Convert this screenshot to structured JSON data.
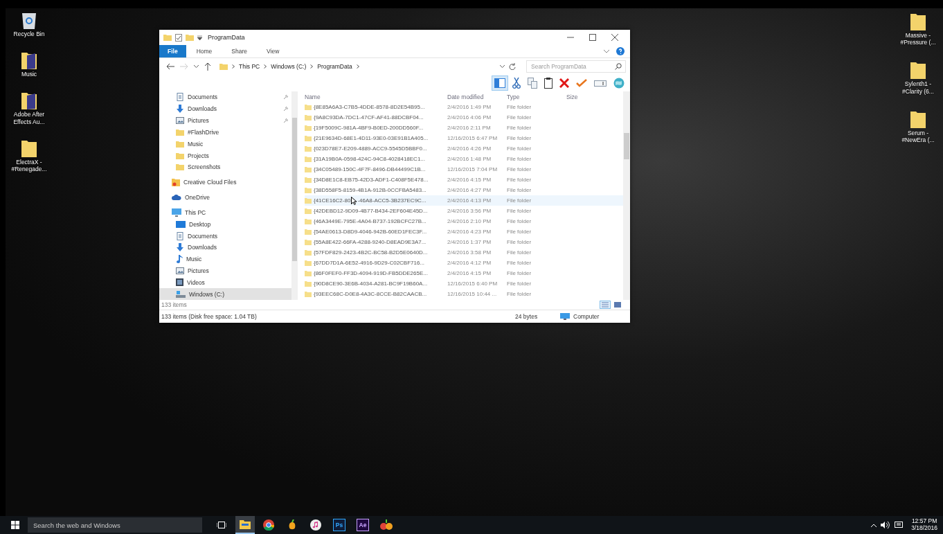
{
  "desktop": {
    "left_icons": [
      {
        "kind": "recycle",
        "label": "Recycle Bin"
      },
      {
        "kind": "media-folder",
        "label": "Music"
      },
      {
        "kind": "media-folder",
        "label": "Adobe After Effects Au..."
      },
      {
        "kind": "folder",
        "label": "ElectraX - #Renegade..."
      }
    ],
    "right_icons": [
      {
        "kind": "folder",
        "label": "Massive - #Pressure (..."
      },
      {
        "kind": "folder",
        "label": "Sylenth1 - #Clarity (6..."
      },
      {
        "kind": "folder",
        "label": "Serum - #NewEra (..."
      }
    ]
  },
  "window": {
    "title": "ProgramData",
    "ribbon_tabs": [
      {
        "label": "File",
        "selected": true
      },
      {
        "label": "Home",
        "selected": false
      },
      {
        "label": "Share",
        "selected": false
      },
      {
        "label": "View",
        "selected": false
      }
    ],
    "breadcrumbs": [
      "This PC",
      "Windows (C:)",
      "ProgramData"
    ],
    "search": {
      "placeholder": "Search ProgramData"
    },
    "toolbar": [
      {
        "kind": "pane",
        "selected": true
      },
      {
        "kind": "cut",
        "selected": false
      },
      {
        "kind": "copy",
        "selected": false
      },
      {
        "kind": "paste",
        "selected": false
      },
      {
        "kind": "delete",
        "selected": false
      },
      {
        "kind": "check",
        "selected": false
      },
      {
        "kind": "rename",
        "selected": false
      },
      {
        "kind": "globe",
        "selected": false
      }
    ],
    "nav": {
      "quick_access": [
        {
          "kind": "documents",
          "label": "Documents",
          "pinned": true
        },
        {
          "kind": "downloads",
          "label": "Downloads",
          "pinned": true
        },
        {
          "kind": "pictures",
          "label": "Pictures",
          "pinned": true
        },
        {
          "kind": "folder",
          "label": "#FlashDrive",
          "pinned": false
        },
        {
          "kind": "folder",
          "label": "Music",
          "pinned": false
        },
        {
          "kind": "folder",
          "label": "Projects",
          "pinned": false
        },
        {
          "kind": "folder",
          "label": "Screenshots",
          "pinned": false
        }
      ],
      "roots": [
        {
          "kind": "creative-cloud",
          "label": "Creative Cloud Files",
          "selected": false
        },
        {
          "kind": "onedrive",
          "label": "OneDrive",
          "selected": false
        },
        {
          "kind": "pc",
          "label": "This PC",
          "selected": false,
          "children": [
            {
              "kind": "desktop",
              "label": "Desktop",
              "selected": false
            },
            {
              "kind": "documents",
              "label": "Documents",
              "selected": false
            },
            {
              "kind": "downloads",
              "label": "Downloads",
              "selected": false
            },
            {
              "kind": "music",
              "label": "Music",
              "selected": false
            },
            {
              "kind": "pictures",
              "label": "Pictures",
              "selected": false
            },
            {
              "kind": "videos",
              "label": "Videos",
              "selected": false
            },
            {
              "kind": "drive",
              "label": "Windows (C:)",
              "selected": true
            }
          ]
        }
      ]
    },
    "columns": [
      "Name",
      "Date modified",
      "Type",
      "Size"
    ],
    "rows": [
      {
        "name": "{8E85A6A3-C7B5-4DDE-8578-8D2E54B95...",
        "date": "2/4/2016 1:49 PM",
        "type": "File folder",
        "hovered": false
      },
      {
        "name": "{9A8C93DA-7DC1-47CF-AF41-88DCBF04...",
        "date": "2/4/2016 4:06 PM",
        "type": "File folder",
        "hovered": false
      },
      {
        "name": "{19F5009C-981A-4BF9-B0ED-200DD560F...",
        "date": "2/4/2016 2:11 PM",
        "type": "File folder",
        "hovered": false
      },
      {
        "name": "{21E9634D-68E1-4D11-93E0-03E91B1A405...",
        "date": "12/16/2015 6:47 PM",
        "type": "File folder",
        "hovered": false
      },
      {
        "name": "{023D78E7-E209-4889-ACC9-5545D5BBF0...",
        "date": "2/4/2016 4:26 PM",
        "type": "File folder",
        "hovered": false
      },
      {
        "name": "{31A19B0A-0598-424C-94C8-4028418EC1...",
        "date": "2/4/2016 1:48 PM",
        "type": "File folder",
        "hovered": false
      },
      {
        "name": "{34C05489-150C-4F7F-8496-DB44499C1B...",
        "date": "12/16/2015 7:04 PM",
        "type": "File folder",
        "hovered": false
      },
      {
        "name": "{34D8E1C8-EB75-42D3-ADF1-C408F5E478...",
        "date": "2/4/2016 4:15 PM",
        "type": "File folder",
        "hovered": false
      },
      {
        "name": "{38D558F5-8159-4B1A-912B-0CCFBA5483...",
        "date": "2/4/2016 4:27 PM",
        "type": "File folder",
        "hovered": false
      },
      {
        "name": "{41CE16C2-80",
        "name_rest": "-46A8-ACC5-3B237EC9C...",
        "date": "2/4/2016 4:13 PM",
        "type": "File folder",
        "hovered": true
      },
      {
        "name": "{42DEBD12-9D09-4B77-B434-2EF604E45D...",
        "date": "2/4/2016 3:56 PM",
        "type": "File folder",
        "hovered": false
      },
      {
        "name": "{46A3449E-795E-4A04-B737-192BCFC27B...",
        "date": "2/4/2016 2:10 PM",
        "type": "File folder",
        "hovered": false
      },
      {
        "name": "{54AE0613-D8D9-4046-942B-60ED1FEC3F...",
        "date": "2/4/2016 4:23 PM",
        "type": "File folder",
        "hovered": false
      },
      {
        "name": "{55A8E422-66FA-4288-9240-D8EAD9E3A7...",
        "date": "2/4/2016 1:37 PM",
        "type": "File folder",
        "hovered": false
      },
      {
        "name": "{57FDF829-2423-4B2C-BC58-B2D5E0640D...",
        "date": "2/4/2016 3:58 PM",
        "type": "File folder",
        "hovered": false
      },
      {
        "name": "{67DD7D1A-6E52-4916-9D29-C02CBF716...",
        "date": "2/4/2016 4:12 PM",
        "type": "File folder",
        "hovered": false
      },
      {
        "name": "{86F0FEF0-FF3D-4094-919D-FB5DDE265E...",
        "date": "2/4/2016 4:15 PM",
        "type": "File folder",
        "hovered": false
      },
      {
        "name": "{90D8CE90-3E6B-4034-A281-BC9F19B60A...",
        "date": "12/16/2015 6:40 PM",
        "type": "File folder",
        "hovered": false
      },
      {
        "name": "{93EEC68C-D0E8-4A3C-8CCE-B82CAACB...",
        "date": "12/16/2015 10:44 ...",
        "type": "File folder",
        "hovered": false
      }
    ],
    "item_count": "133 items",
    "status": {
      "summary": "133 items (Disk free space: 1.04 TB)",
      "size": "24 bytes",
      "location": "Computer"
    },
    "views": [
      {
        "kind": "details",
        "selected": true
      },
      {
        "kind": "tiles",
        "selected": false
      }
    ]
  },
  "taskbar": {
    "search": {
      "placeholder": "Search the web and Windows"
    },
    "apps": [
      {
        "kind": "task-view",
        "active": false
      },
      {
        "kind": "explorer",
        "active": true
      },
      {
        "kind": "chrome",
        "active": false
      },
      {
        "kind": "fruity",
        "active": false
      },
      {
        "kind": "itunes",
        "active": false
      },
      {
        "kind": "ps",
        "label": "Ps",
        "active": false
      },
      {
        "kind": "ae",
        "label": "Ae",
        "active": false
      },
      {
        "kind": "plugin",
        "active": false
      }
    ],
    "time": "12:57 PM",
    "date": "3/18/2016"
  }
}
